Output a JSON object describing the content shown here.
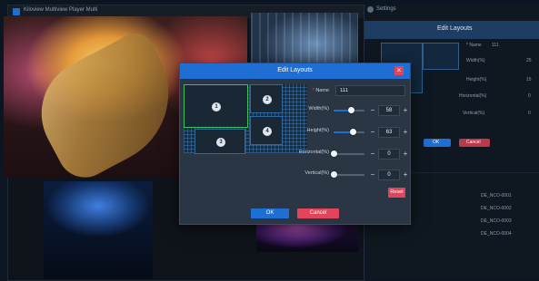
{
  "background_app": {
    "title": "Kiloview Multiview Player Multi"
  },
  "settings_panel": {
    "title": "Settings",
    "subheader": "Edit Layouts",
    "name_label": "* Name",
    "name_value": "111",
    "width_label": "Width(%)",
    "width_value": "25",
    "height_label": "Height(%)",
    "height_value": "15",
    "horizontal_label": "Horizontal(%)",
    "horizontal_value": "0",
    "vertical_label": "Vertical(%)",
    "vertical_value": "0",
    "ok_label": "OK",
    "cancel_label": "Cancel",
    "rows": [
      "DE_NCO-0001",
      "DE_NCO-0002",
      "DE_NCO-0003",
      "DE_NCO-0004"
    ]
  },
  "modal": {
    "title": "Edit Layouts",
    "close_glyph": "×",
    "layout_boxes": [
      {
        "number": "1",
        "selected": true
      },
      {
        "number": "2",
        "selected": false
      },
      {
        "number": "3",
        "selected": false
      },
      {
        "number": "4",
        "selected": false
      }
    ],
    "name": {
      "label": "Name",
      "required_mark": "*",
      "value": "111"
    },
    "width": {
      "label": "Width(%)",
      "value": "58",
      "level": 0.58
    },
    "height": {
      "label": "Height(%)",
      "value": "63",
      "level": 0.63
    },
    "horizontal": {
      "label": "Horizontal(%)",
      "value": "0",
      "level": 0
    },
    "vertical": {
      "label": "Vertical(%)",
      "value": "0",
      "level": 0
    },
    "minus_glyph": "−",
    "plus_glyph": "+",
    "reset_label": "Reset",
    "ok_label": "OK",
    "cancel_label": "Cancel"
  },
  "colors": {
    "accent": "#1f6ed4",
    "danger": "#e1445b",
    "selected": "#3fc05a"
  }
}
